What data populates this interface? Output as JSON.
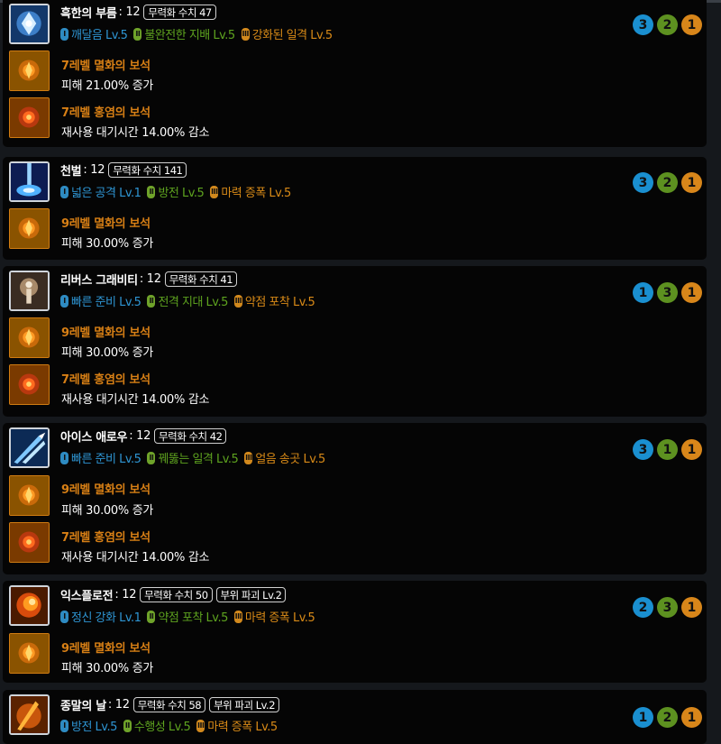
{
  "skills": [
    {
      "name": "흑한의 부름",
      "level": ": 12",
      "badges": [
        "무력화 수치 47"
      ],
      "tripods": [
        {
          "tier": "I",
          "label": "깨달음 Lv.5"
        },
        {
          "tier": "II",
          "label": "불완전한 지배 Lv.5"
        },
        {
          "tier": "III",
          "label": "강화된 일격 Lv.5"
        }
      ],
      "circles": [
        "3",
        "2",
        "1"
      ],
      "gems": [
        {
          "name": "7레벨 멸화의 보석",
          "effect": "피해 21.00% 증가"
        },
        {
          "name": "7레벨 홍염의 보석",
          "effect": "재사용 대기시간 14.00% 감소"
        }
      ]
    },
    {
      "name": "천벌",
      "level": ": 12",
      "badges": [
        "무력화 수치 141"
      ],
      "tripods": [
        {
          "tier": "I",
          "label": "넓은 공격 Lv.1"
        },
        {
          "tier": "II",
          "label": "방전 Lv.5"
        },
        {
          "tier": "III",
          "label": "마력 증폭 Lv.5"
        }
      ],
      "circles": [
        "3",
        "2",
        "1"
      ],
      "gems": [
        {
          "name": "9레벨 멸화의 보석",
          "effect": "피해 30.00% 증가"
        }
      ]
    },
    {
      "name": "리버스 그래비티",
      "level": ": 12",
      "badges": [
        "무력화 수치 41"
      ],
      "tripods": [
        {
          "tier": "I",
          "label": "빠른 준비 Lv.5"
        },
        {
          "tier": "II",
          "label": "전격 지대 Lv.5"
        },
        {
          "tier": "III",
          "label": "약점 포착 Lv.5"
        }
      ],
      "circles": [
        "1",
        "3",
        "1"
      ],
      "gems": [
        {
          "name": "9레벨 멸화의 보석",
          "effect": "피해 30.00% 증가"
        },
        {
          "name": "7레벨 홍염의 보석",
          "effect": "재사용 대기시간 14.00% 감소"
        }
      ]
    },
    {
      "name": "아이스 애로우",
      "level": ": 12",
      "badges": [
        "무력화 수치 42"
      ],
      "tripods": [
        {
          "tier": "I",
          "label": "빠른 준비 Lv.5"
        },
        {
          "tier": "II",
          "label": "꿰뚫는 일격 Lv.5"
        },
        {
          "tier": "III",
          "label": "얼음 송곳 Lv.5"
        }
      ],
      "circles": [
        "3",
        "1",
        "1"
      ],
      "gems": [
        {
          "name": "9레벨 멸화의 보석",
          "effect": "피해 30.00% 증가"
        },
        {
          "name": "7레벨 홍염의 보석",
          "effect": "재사용 대기시간 14.00% 감소"
        }
      ]
    },
    {
      "name": "익스플로전",
      "level": ": 12",
      "badges": [
        "무력화 수치 50",
        "부위 파괴 Lv.2"
      ],
      "tripods": [
        {
          "tier": "I",
          "label": "정신 강화 Lv.1"
        },
        {
          "tier": "II",
          "label": "약점 포착 Lv.5"
        },
        {
          "tier": "III",
          "label": "마력 증폭 Lv.5"
        }
      ],
      "circles": [
        "2",
        "3",
        "1"
      ],
      "gems": [
        {
          "name": "9레벨 멸화의 보석",
          "effect": "피해 30.00% 증가"
        }
      ]
    },
    {
      "name": "종말의 날",
      "level": ": 12",
      "badges": [
        "무력화 수치 58",
        "부위 파괴 Lv.2"
      ],
      "tripods": [
        {
          "tier": "I",
          "label": "방전 Lv.5"
        },
        {
          "tier": "II",
          "label": "수행성 Lv.5"
        },
        {
          "tier": "III",
          "label": "마력 증폭 Lv.5"
        }
      ],
      "circles": [
        "1",
        "2",
        "1"
      ],
      "gems": []
    }
  ]
}
